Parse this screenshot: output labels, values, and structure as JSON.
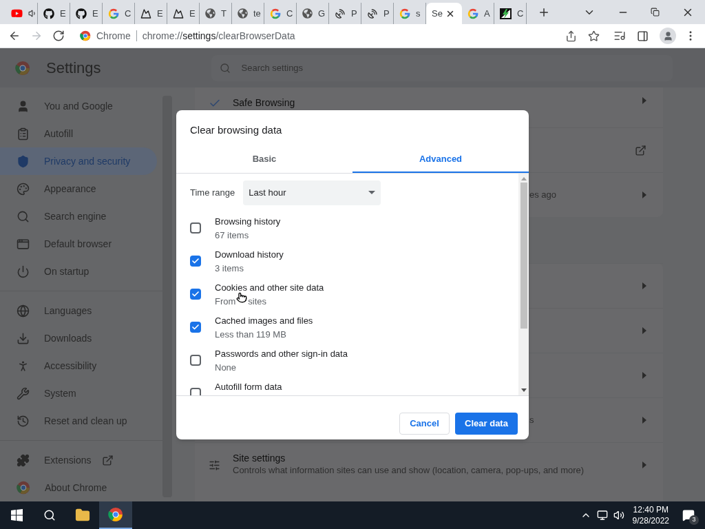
{
  "browser": {
    "tabs": [
      {
        "kind": "youtube",
        "audio": true,
        "selected": false
      },
      {
        "kind": "github",
        "label": "E",
        "selected": false
      },
      {
        "kind": "github",
        "label": "E",
        "selected": false
      },
      {
        "kind": "google",
        "label": "C",
        "selected": false
      },
      {
        "kind": "mountain",
        "label": "E",
        "selected": false
      },
      {
        "kind": "mountain",
        "label": "E",
        "selected": false
      },
      {
        "kind": "globe",
        "label": "T",
        "selected": false
      },
      {
        "kind": "globe",
        "label": "te",
        "selected": false
      },
      {
        "kind": "google",
        "label": "C",
        "selected": false
      },
      {
        "kind": "globe",
        "label": "G",
        "selected": false
      },
      {
        "kind": "dish",
        "label": "P",
        "selected": false
      },
      {
        "kind": "dish",
        "label": "P",
        "selected": false
      },
      {
        "kind": "google",
        "label": "s",
        "selected": false
      },
      {
        "kind": "blank",
        "label": "Se",
        "selected": true
      },
      {
        "kind": "google",
        "label": "A",
        "selected": false
      },
      {
        "kind": "bolt",
        "label": "C",
        "selected": false
      }
    ],
    "nav": [
      {
        "kind": "back",
        "disabled": false
      },
      {
        "kind": "forward",
        "disabled": true
      },
      {
        "kind": "reload",
        "disabled": false
      }
    ],
    "omnibox": {
      "site": "Chrome",
      "url_scheme": "chrome://",
      "url_host": "settings",
      "url_path": "/clearBrowserData"
    }
  },
  "settings": {
    "title": "Settings",
    "search": {
      "placeholder": "Search settings"
    },
    "sidebar": {
      "groups": [
        [
          {
            "kind": "person",
            "label": "You and Google",
            "selected": false
          },
          {
            "kind": "clipboard",
            "label": "Autofill",
            "selected": false
          },
          {
            "kind": "shield",
            "label": "Privacy and security",
            "selected": true
          },
          {
            "kind": "palette",
            "label": "Appearance",
            "selected": false
          },
          {
            "kind": "search",
            "label": "Search engine",
            "selected": false
          },
          {
            "kind": "browser",
            "label": "Default browser",
            "selected": false
          },
          {
            "kind": "power",
            "label": "On startup",
            "selected": false
          }
        ],
        [
          {
            "kind": "globe",
            "label": "Languages",
            "selected": false
          },
          {
            "kind": "download",
            "label": "Downloads",
            "selected": false
          },
          {
            "kind": "accessibility",
            "label": "Accessibility",
            "selected": false
          },
          {
            "kind": "wrench",
            "label": "System",
            "selected": false
          },
          {
            "kind": "history",
            "label": "Reset and clean up",
            "selected": false
          }
        ],
        [
          {
            "kind": "puzzle",
            "label": "Extensions",
            "external": true,
            "selected": false
          },
          {
            "kind": "chrome",
            "label": "About Chrome",
            "selected": false
          }
        ]
      ]
    },
    "cards": [
      {
        "rows": [
          {
            "kind": "check",
            "title": "Safe Browsing"
          },
          {
            "kind": "external"
          },
          {
            "kind": "arrow",
            "text": "es ago"
          }
        ]
      },
      {
        "rows": [
          {
            "kind": "arrow"
          },
          {
            "kind": "arrow"
          },
          {
            "kind": "arrow"
          },
          {
            "kind": "arrow",
            "text": "s"
          },
          {
            "kind": "tune",
            "title": "Site settings",
            "text": "Controls what information sites can use and show (location, camera, pop-ups, and more)"
          }
        ]
      }
    ]
  },
  "dialog": {
    "title": "Clear browsing data",
    "tabs": [
      {
        "label": "Basic",
        "selected": false
      },
      {
        "label": "Advanced",
        "selected": true
      }
    ],
    "time_range": {
      "label": "Time range",
      "value": "Last hour"
    },
    "items": [
      {
        "title": "Browsing history",
        "detail": "67 items",
        "checked": false
      },
      {
        "title": "Download history",
        "detail": "3 items",
        "checked": true
      },
      {
        "title": "Cookies and other site data",
        "detail_parts": [
          "From",
          "sites"
        ],
        "checked": true
      },
      {
        "title": "Cached images and files",
        "detail": "Less than 119 MB",
        "checked": true
      },
      {
        "title": "Passwords and other sign-in data",
        "detail": "None",
        "checked": false
      },
      {
        "title": "Autofill form data",
        "checked": false
      }
    ],
    "buttons": [
      {
        "kind": "secondary",
        "label": "Cancel"
      },
      {
        "kind": "primary",
        "label": "Clear data"
      }
    ]
  },
  "taskbar": {
    "apps": [
      {
        "kind": "explorer",
        "selected": false
      },
      {
        "kind": "chrome",
        "selected": true
      }
    ],
    "time": "12:40 PM",
    "date": "9/28/2022",
    "notifications": "3"
  }
}
